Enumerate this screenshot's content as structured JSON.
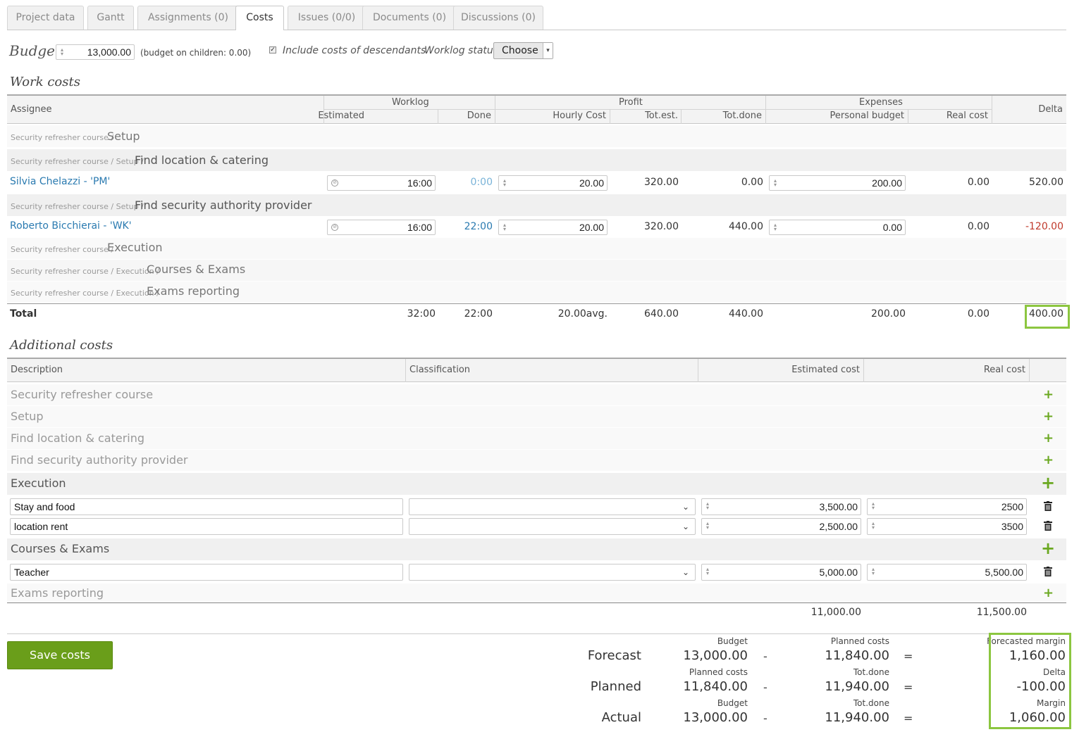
{
  "tabs": [
    {
      "label": "Project data"
    },
    {
      "label": "Gantt"
    },
    {
      "label": "Assignments (0)"
    },
    {
      "label": "Costs"
    },
    {
      "label": "Issues (0/0)"
    },
    {
      "label": "Documents (0)"
    },
    {
      "label": "Discussions (0)"
    }
  ],
  "budget": {
    "label": "Budget",
    "value": "13,000.00",
    "children_note": "(budget on children: 0.00)",
    "include_descendants_label": "Include costs of descendants",
    "include_descendants_checked": true,
    "worklog_status_label": "Worklog status",
    "worklog_status_value": "Choose"
  },
  "work_costs": {
    "title": "Work costs",
    "headers": {
      "assignee": "Assignee",
      "worklog": "Worklog",
      "profit": "Profit",
      "expenses": "Expenses",
      "estimated": "Estimated",
      "done": "Done",
      "hourly_cost": "Hourly Cost",
      "tot_est": "Tot.est.",
      "tot_done": "Tot.done",
      "personal_budget": "Personal budget",
      "real_cost": "Real cost",
      "delta": "Delta"
    },
    "rows": {
      "r0": {
        "crumb": "Security refresher course /",
        "task": "Setup"
      },
      "r1": {
        "crumb": "Security refresher course / Setup /",
        "task": "Find location & catering"
      },
      "r2": {
        "assignee": "Silvia Chelazzi - 'PM'",
        "estimated": "16:00",
        "done": "0:00",
        "hourly": "20.00",
        "tot_est": "320.00",
        "tot_done": "0.00",
        "personal_budget": "200.00",
        "real_cost": "0.00",
        "delta": "520.00"
      },
      "r3": {
        "crumb": "Security refresher course / Setup /",
        "task": "Find security authority provider"
      },
      "r4": {
        "assignee": "Roberto Bicchierai - 'WK'",
        "estimated": "16:00",
        "done": "22:00",
        "hourly": "20.00",
        "tot_est": "320.00",
        "tot_done": "440.00",
        "personal_budget": "0.00",
        "real_cost": "0.00",
        "delta": "-120.00"
      },
      "r5": {
        "crumb": "Security refresher course /",
        "task": "Execution"
      },
      "r6": {
        "crumb": "Security refresher course / Execution /",
        "task": "Courses & Exams"
      },
      "r7": {
        "crumb": "Security refresher course / Execution /",
        "task": "Exams reporting"
      }
    },
    "total": {
      "label": "Total",
      "estimated": "32:00",
      "done": "22:00",
      "hourly": "20.00avg.",
      "tot_est": "640.00",
      "tot_done": "440.00",
      "personal_budget": "200.00",
      "real_cost": "0.00",
      "delta": "400.00"
    }
  },
  "additional_costs": {
    "title": "Additional costs",
    "headers": {
      "description": "Description",
      "classification": "Classification",
      "estimated_cost": "Estimated cost",
      "real_cost": "Real cost"
    },
    "groups": {
      "g0": "Security refresher course",
      "g1": "Setup",
      "g2": "Find location & catering",
      "g3": "Find security authority provider",
      "g4": "Execution",
      "g5": "Courses & Exams",
      "g6": "Exams reporting"
    },
    "items": {
      "i0": {
        "description": "Stay and food",
        "estimated": "3,500.00",
        "real": "2500"
      },
      "i1": {
        "description": "location rent",
        "estimated": "2,500.00",
        "real": "3500"
      },
      "i2": {
        "description": "Teacher",
        "estimated": "5,000.00",
        "real": "5,500.00"
      }
    },
    "totals": {
      "estimated": "11,000.00",
      "real": "11,500.00"
    },
    "plus_glyph": "+"
  },
  "save_button": "Save costs",
  "summary": {
    "forecast": {
      "label": "Forecast",
      "a_caption": "Budget",
      "a": "13,000.00",
      "b_caption": "Planned costs",
      "b": "11,840.00",
      "r_caption": "Forecasted margin",
      "r": "1,160.00"
    },
    "planned": {
      "label": "Planned",
      "a_caption": "Planned costs",
      "a": "11,840.00",
      "b_caption": "Tot.done",
      "b": "11,940.00",
      "r_caption": "Delta",
      "r": "-100.00"
    },
    "actual": {
      "label": "Actual",
      "a_caption": "Budget",
      "a": "13,000.00",
      "b_caption": "Tot.done",
      "b": "11,940.00",
      "r_caption": "Margin",
      "r": "1,060.00"
    },
    "minus": "-",
    "equals": "="
  },
  "colors": {
    "accent_green": "#6a9e1a",
    "highlight_green": "#8cc640",
    "link_blue": "#2a7ab0",
    "negative_red": "#c0392b"
  },
  "icons": {
    "clock": "clock-icon",
    "spinner": "spinner-icon",
    "trash": "trash-icon",
    "plus": "plus-icon",
    "chevron": "chevron-down-icon",
    "checkbox": "checkbox-icon"
  }
}
